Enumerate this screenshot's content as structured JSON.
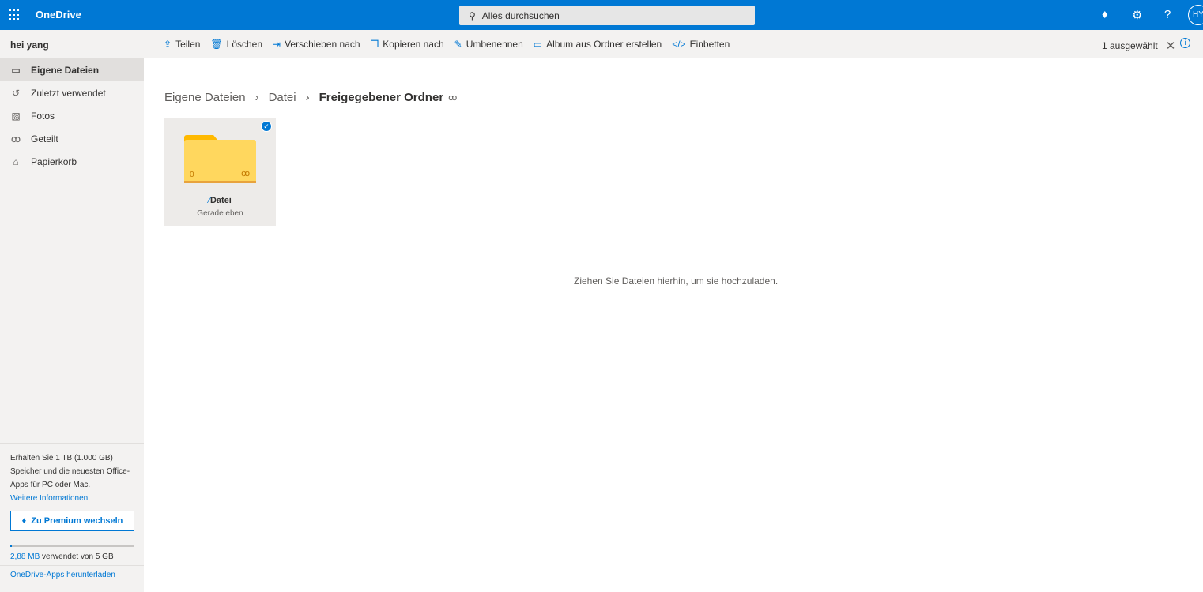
{
  "header": {
    "app_name": "OneDrive",
    "search_placeholder": "Alles durchsuchen",
    "avatar_initials": "HY"
  },
  "commandbar": {
    "user_name": "hei yang",
    "commands": [
      {
        "label": "Teilen",
        "icon": "share-icon"
      },
      {
        "label": "Löschen",
        "icon": "trash-icon"
      },
      {
        "label": "Verschieben nach",
        "icon": "move-icon"
      },
      {
        "label": "Kopieren nach",
        "icon": "copy-icon"
      },
      {
        "label": "Umbenennen",
        "icon": "rename-icon"
      },
      {
        "label": "Album aus Ordner erstellen",
        "icon": "album-icon"
      },
      {
        "label": "Einbetten",
        "icon": "embed-icon"
      }
    ],
    "selection_text": "1 ausgewählt"
  },
  "sidebar": {
    "items": [
      {
        "label": "Eigene Dateien",
        "active": true
      },
      {
        "label": "Zuletzt verwendet"
      },
      {
        "label": "Fotos"
      },
      {
        "label": "Geteilt"
      },
      {
        "label": "Papierkorb"
      }
    ],
    "promo_text": "Erhalten Sie 1 TB (1.000 GB) Speicher und die neuesten Office-Apps für PC oder Mac.",
    "promo_link": "Weitere Informationen.",
    "premium_button": "Zu Premium wechseln",
    "storage_used": "2,88 MB",
    "storage_rest": " verwendet von 5 GB",
    "storage_fraction": 0.0006,
    "download_link": "OneDrive-Apps herunterladen"
  },
  "main": {
    "breadcrumb": [
      "Eigene Dateien",
      "Datei",
      "Freigegebener Ordner"
    ],
    "folder": {
      "name": "Datei",
      "modified": "Gerade eben",
      "count": "0",
      "selected": true
    },
    "drop_hint": "Ziehen Sie Dateien hierhin, um sie hochzuladen."
  },
  "colors": {
    "accent": "#0078d4",
    "folder": "#ffd75e",
    "folder_tab": "#ffb900"
  }
}
